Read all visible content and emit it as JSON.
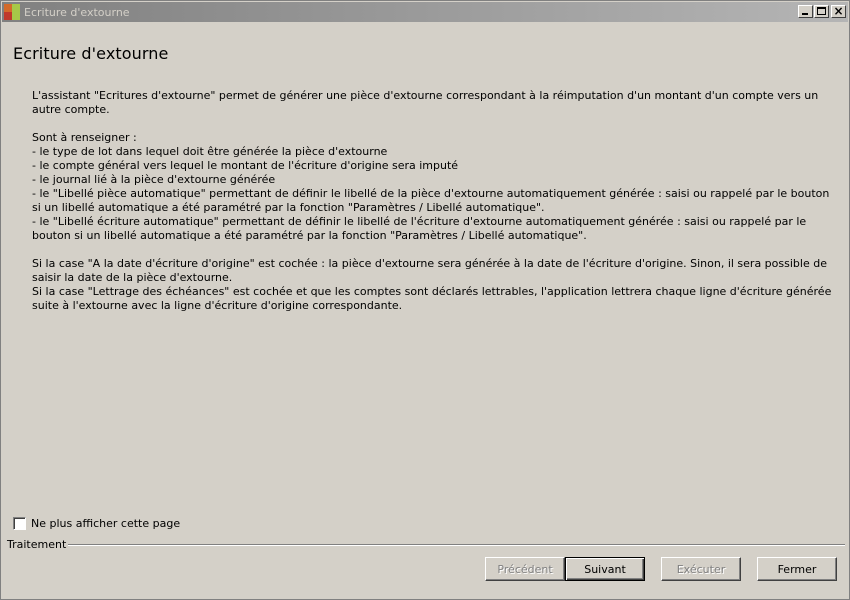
{
  "window": {
    "title": "Ecriture d'extourne"
  },
  "page": {
    "title": "Ecriture d'extourne",
    "paragraphs": [
      "L'assistant \"Ecritures d'extourne\" permet de générer une pièce d'extourne correspondant à la réimputation d'un montant d'un compte vers un autre compte.",
      "Sont à renseigner :",
      "- le type de lot dans lequel doit être générée la pièce d'extourne",
      "- le compte général vers lequel le montant de l'écriture d'origine sera imputé",
      "- le journal lié à la pièce d'extourne générée",
      "- le \"Libellé pièce automatique\" permettant de définir le libellé de la pièce d'extourne automatiquement générée : saisi ou rappelé par le bouton si un libellé automatique a été paramétré par la fonction \"Paramètres / Libellé automatique\".",
      "- le \"Libellé écriture automatique\" permettant de définir le libellé de l'écriture d'extourne automatiquement générée : saisi ou rappelé par le bouton si un libellé automatique a été paramétré par la fonction \"Paramètres / Libellé automatique\".",
      "Si la case \"A la date d'écriture d'origine\" est cochée : la pièce d'extourne sera générée à la date de l'écriture d'origine. Sinon, il sera possible de saisir la date de la pièce d'extourne.",
      "Si la case \"Lettrage des échéances\" est cochée et que les comptes sont déclarés lettrables, l'application lettrera chaque ligne d'écriture générée suite à l'extourne avec la ligne d'écriture d'origine correspondante."
    ]
  },
  "options": {
    "hide_page_label": "Ne plus afficher cette page",
    "hide_page_checked": false
  },
  "footer": {
    "group_label": "Traitement",
    "buttons": {
      "previous": "Précédent",
      "next": "Suivant",
      "execute": "Exécuter",
      "close": "Fermer"
    }
  },
  "colors": {
    "face": "#d4d0c8",
    "titlebar_start": "#808080",
    "titlebar_end": "#b5b5b5",
    "disabled_text": "#808080"
  }
}
